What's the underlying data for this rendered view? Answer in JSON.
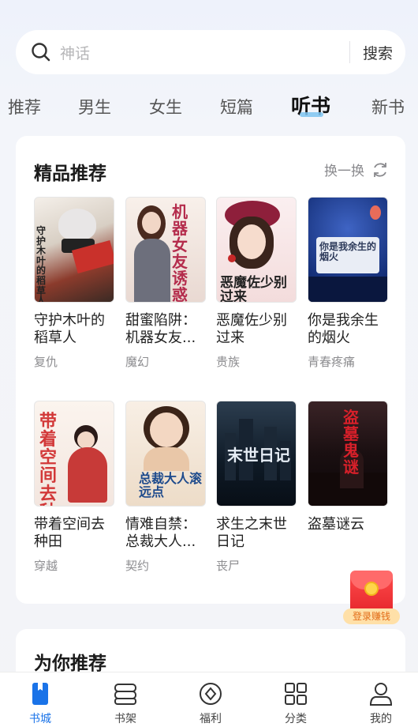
{
  "search": {
    "placeholder": "神话",
    "button": "搜索"
  },
  "tabs": [
    "推荐",
    "男生",
    "女生",
    "短篇",
    "听书",
    "新书"
  ],
  "active_tab": "听书",
  "featured": {
    "title": "精品推荐",
    "refresh_label": "换一换",
    "books": [
      {
        "title": "守护木叶的稻草人",
        "genre": "复仇",
        "cover_text": "守护木叶的稻草人"
      },
      {
        "title": "甜蜜陷阱：机器女友...",
        "genre": "魔幻",
        "cover_text": "机器女友诱惑爱"
      },
      {
        "title": "恶魔佐少别过来",
        "genre": "贵族",
        "cover_text": "恶魔佐少别过来"
      },
      {
        "title": "你是我余生的烟火",
        "genre": "青春疼痛",
        "cover_text": "你是我余生的烟火"
      },
      {
        "title": "带着空间去种田",
        "genre": "穿越",
        "cover_text": "带着空间去种田"
      },
      {
        "title": "情难自禁：总裁大人...",
        "genre": "契约",
        "cover_text": "总裁大人滚远点"
      },
      {
        "title": "求生之末世日记",
        "genre": "丧尸",
        "cover_text": "末世日记"
      },
      {
        "title": "盗墓谜云",
        "genre": "",
        "cover_text": "盗墓鬼谜"
      }
    ]
  },
  "for_you": {
    "title": "为你推荐"
  },
  "red_packet": {
    "label": "登录赚钱"
  },
  "nav": [
    {
      "label": "书城",
      "icon": "bookstore-icon"
    },
    {
      "label": "书架",
      "icon": "bookshelf-icon"
    },
    {
      "label": "福利",
      "icon": "welfare-icon"
    },
    {
      "label": "分类",
      "icon": "category-icon"
    },
    {
      "label": "我的",
      "icon": "profile-icon"
    }
  ],
  "colors": {
    "accent": "#1a73e8",
    "tab_underline": "#7ec4f0",
    "red_packet": "#e5252b"
  }
}
